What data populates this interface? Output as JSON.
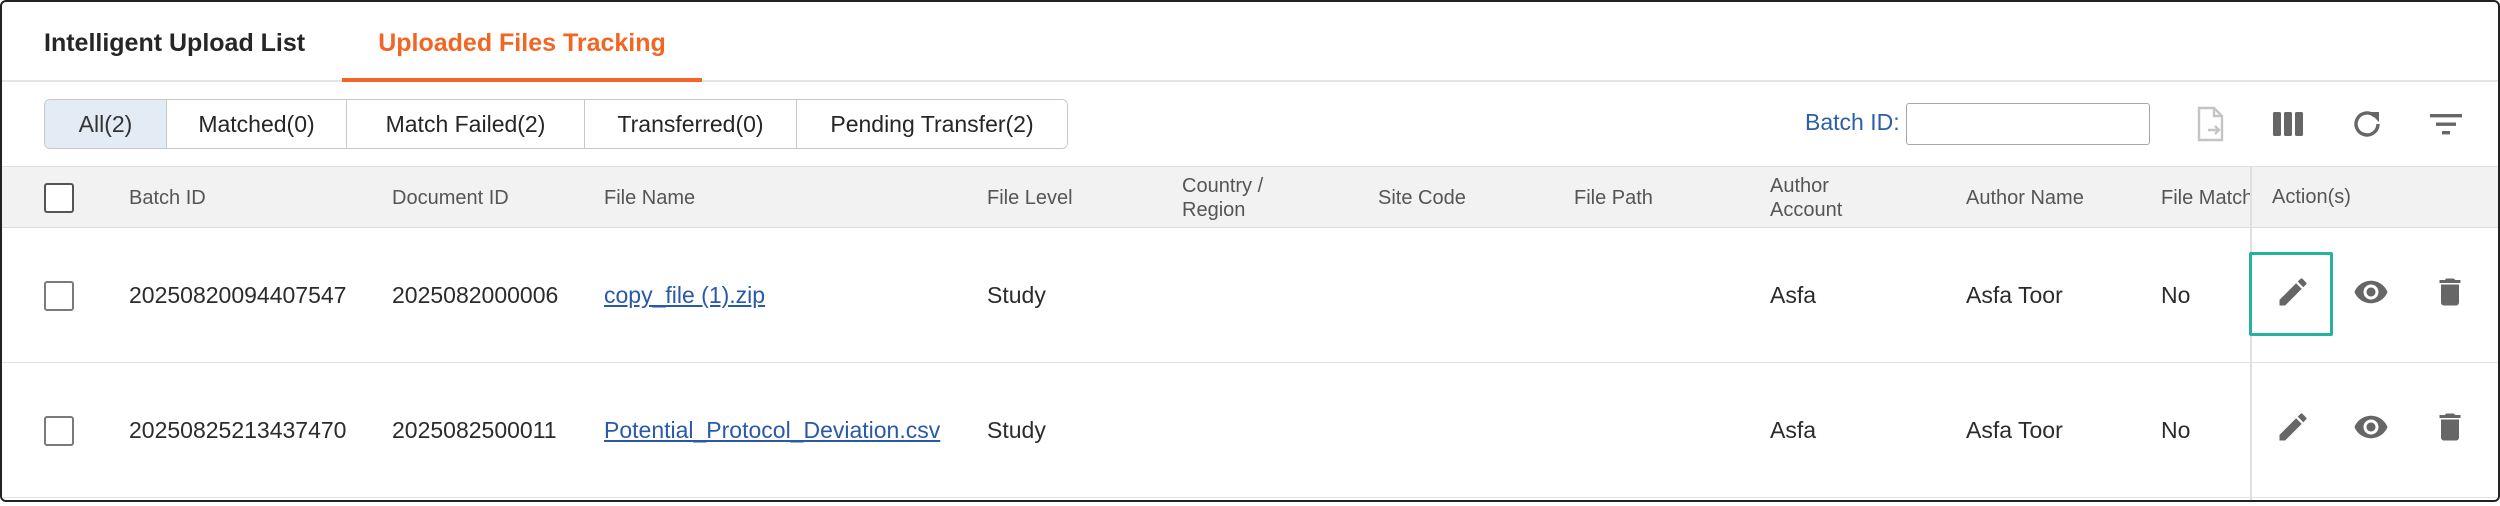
{
  "tabs": [
    {
      "label": "Intelligent Upload List",
      "active": false
    },
    {
      "label": "Uploaded Files Tracking",
      "active": true
    }
  ],
  "filters": [
    {
      "label": "All(2)",
      "active": true
    },
    {
      "label": "Matched(0)",
      "active": false
    },
    {
      "label": "Match Failed(2)",
      "active": false
    },
    {
      "label": "Transferred(0)",
      "active": false
    },
    {
      "label": "Pending Transfer(2)",
      "active": false
    }
  ],
  "batch_search": {
    "label": "Batch ID:",
    "value": ""
  },
  "toolbar_icons": [
    "export-file-icon",
    "columns-icon",
    "refresh-icon",
    "filter-icon"
  ],
  "columns": [
    "Batch ID",
    "Document ID",
    "File Name",
    "File Level",
    "Country / Region",
    "Site Code",
    "File Path",
    "Author Account",
    "Author Name",
    "File Match",
    "Action(s)"
  ],
  "rows": [
    {
      "batch_id": "20250820094407547",
      "document_id": "2025082000006",
      "file_name": "copy_file (1).zip",
      "file_level": "Study",
      "country_region": "",
      "site_code": "",
      "file_path": "",
      "author_account": "Asfa",
      "author_name": "Asfa Toor",
      "file_match": "No"
    },
    {
      "batch_id": "20250825213437470",
      "document_id": "2025082500011",
      "file_name": "Potential_Protocol_Deviation.csv",
      "file_level": "Study",
      "country_region": "",
      "site_code": "",
      "file_path": "",
      "author_account": "Asfa",
      "author_name": "Asfa Toor",
      "file_match": "No"
    }
  ],
  "colors": {
    "accent": "#f26522",
    "link": "#2a59a8",
    "focus": "#27b39a",
    "icon": "#666666"
  }
}
